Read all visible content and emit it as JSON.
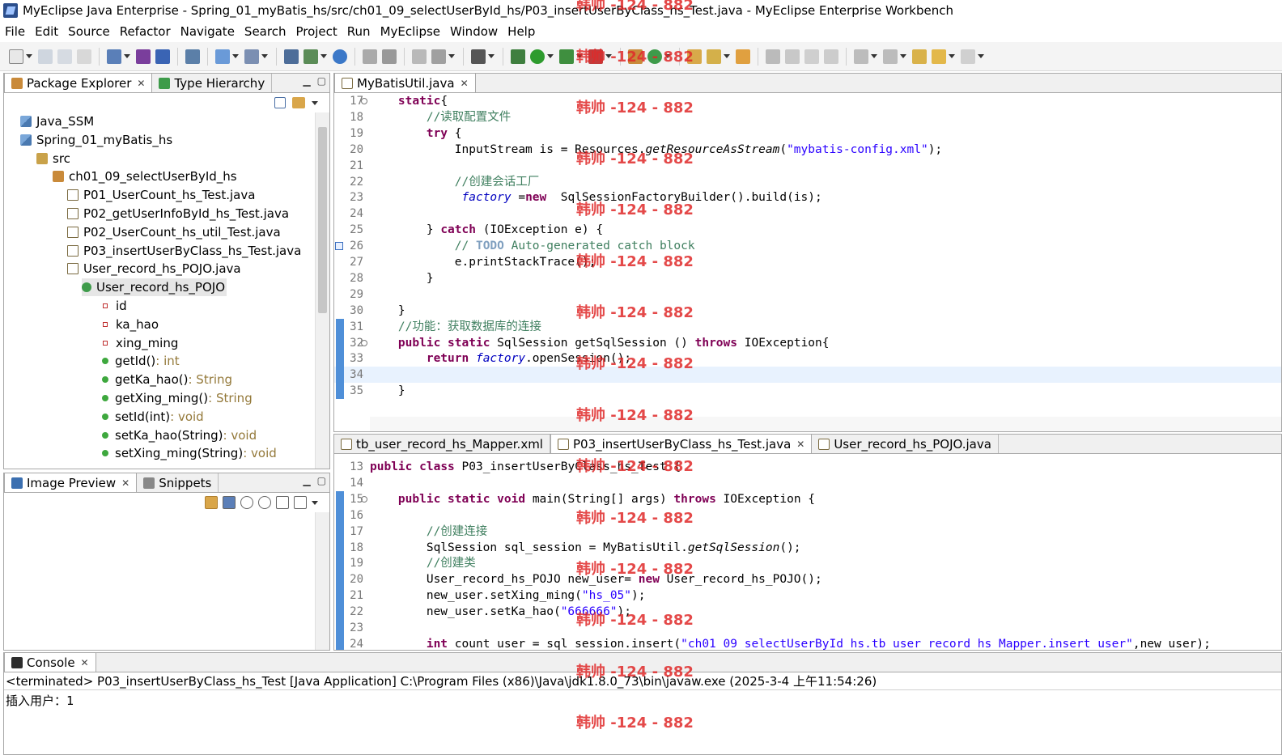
{
  "window": {
    "title": "MyEclipse Java Enterprise - Spring_01_myBatis_hs/src/ch01_09_selectUserById_hs/P03_insertUserByClass_hs_Test.java - MyEclipse Enterprise Workbench"
  },
  "menu": [
    "File",
    "Edit",
    "Source",
    "Refactor",
    "Navigate",
    "Search",
    "Project",
    "Run",
    "MyEclipse",
    "Window",
    "Help"
  ],
  "package_explorer": {
    "tabs": [
      {
        "label": "Package Explorer",
        "icon": "package-explorer-icon",
        "active": true
      },
      {
        "label": "Type Hierarchy",
        "icon": "type-hierarchy-icon",
        "active": false
      }
    ],
    "tree": [
      {
        "depth": 0,
        "icon": "project",
        "label": "Java_SSM"
      },
      {
        "depth": 0,
        "icon": "project",
        "label": "Spring_01_myBatis_hs"
      },
      {
        "depth": 1,
        "icon": "src",
        "label": "src"
      },
      {
        "depth": 2,
        "icon": "package",
        "label": "ch01_09_selectUserById_hs"
      },
      {
        "depth": 3,
        "icon": "java",
        "label": "P01_UserCount_hs_Test.java"
      },
      {
        "depth": 3,
        "icon": "java",
        "label": "P02_getUserInfoById_hs_Test.java"
      },
      {
        "depth": 3,
        "icon": "java",
        "label": "P02_UserCount_hs_util_Test.java"
      },
      {
        "depth": 3,
        "icon": "java",
        "label": "P03_insertUserByClass_hs_Test.java"
      },
      {
        "depth": 3,
        "icon": "java",
        "label": "User_record_hs_POJO.java"
      },
      {
        "depth": 4,
        "icon": "class",
        "label": "User_record_hs_POJO",
        "selected": true
      },
      {
        "depth": 5,
        "icon": "field",
        "label": "id"
      },
      {
        "depth": 5,
        "icon": "field",
        "label": "ka_hao"
      },
      {
        "depth": 5,
        "icon": "field",
        "label": "xing_ming"
      },
      {
        "depth": 5,
        "icon": "method",
        "label": "getId()",
        "type": " : int"
      },
      {
        "depth": 5,
        "icon": "method",
        "label": "getKa_hao()",
        "type": " : String"
      },
      {
        "depth": 5,
        "icon": "method",
        "label": "getXing_ming()",
        "type": " : String"
      },
      {
        "depth": 5,
        "icon": "method",
        "label": "setId(int)",
        "type": " : void"
      },
      {
        "depth": 5,
        "icon": "method",
        "label": "setKa_hao(String)",
        "type": " : void"
      },
      {
        "depth": 5,
        "icon": "method",
        "label": "setXing_ming(String)",
        "type": " : void"
      }
    ]
  },
  "preview": {
    "tabs": [
      {
        "label": "Image Preview",
        "icon": "image-preview-icon",
        "active": true
      },
      {
        "label": "Snippets",
        "icon": "snippets-icon",
        "active": false
      }
    ]
  },
  "editor_top": {
    "tabs": [
      {
        "label": "MyBatisUtil.java",
        "icon": "java-file-icon",
        "active": true
      }
    ],
    "lines": [
      {
        "n": "17",
        "html": "    <span class='kw'>static</span>{",
        "fold": true
      },
      {
        "n": "18",
        "html": "        <span class='cm'>//读取配置文件</span>"
      },
      {
        "n": "19",
        "html": "        <span class='kw'>try</span> {"
      },
      {
        "n": "20",
        "html": "            InputStream is = Resources.<span class='it'>getResourceAsStream</span>(<span class='st'>\"mybatis-config.xml\"</span>);"
      },
      {
        "n": "21",
        "html": ""
      },
      {
        "n": "22",
        "html": "            <span class='cm'>//创建会话工厂</span>"
      },
      {
        "n": "23",
        "html": "             <span class='fd'>factory</span> =<span class='kw'>new</span>  SqlSessionFactoryBuilder().build(is);"
      },
      {
        "n": "24",
        "html": ""
      },
      {
        "n": "25",
        "html": "        } <span class='kw'>catch</span> (IOException e) {"
      },
      {
        "n": "26",
        "html": "            <span class='cm'>// <span class='todo'>TODO</span> Auto-generated catch block</span>",
        "task": true
      },
      {
        "n": "27",
        "html": "            e.printStackTrace();"
      },
      {
        "n": "28",
        "html": "        }"
      },
      {
        "n": "29",
        "html": ""
      },
      {
        "n": "30",
        "html": "    }"
      },
      {
        "n": "31",
        "html": "    <span class='cm'>//功能：获取数据库的连接</span>",
        "changed": true
      },
      {
        "n": "32",
        "html": "    <span class='kw'>public</span> <span class='kw'>static</span> SqlSession getSqlSession () <span class='kw'>throws</span> IOException{",
        "fold": true,
        "changed": true
      },
      {
        "n": "33",
        "html": "        <span class='kw'>return</span> <span class='fd'>factory</span>.openSession();",
        "changed": true
      },
      {
        "n": "34",
        "html": "",
        "current": true,
        "changed": true
      },
      {
        "n": "35",
        "html": "    }",
        "changed": true
      }
    ]
  },
  "editor_bottom": {
    "tabs": [
      {
        "label": "tb_user_record_hs_Mapper.xml",
        "icon": "xml-file-icon",
        "active": false
      },
      {
        "label": "P03_insertUserByClass_hs_Test.java",
        "icon": "java-file-icon",
        "active": true
      },
      {
        "label": "User_record_hs_POJO.java",
        "icon": "java-file-icon",
        "active": false
      }
    ],
    "lines": [
      {
        "n": "13",
        "html": "<span class='kw'>public</span> <span class='kw'>class</span> P03_insertUserByClass_hs_Test {"
      },
      {
        "n": "14",
        "html": ""
      },
      {
        "n": "15",
        "html": "    <span class='kw'>public</span> <span class='kw'>static</span> <span class='kw'>void</span> main(String[] args) <span class='kw'>throws</span> IOException {",
        "fold": true,
        "changed": true
      },
      {
        "n": "16",
        "html": "",
        "changed": true
      },
      {
        "n": "17",
        "html": "        <span class='cm'>//创建连接</span>",
        "changed": true
      },
      {
        "n": "18",
        "html": "        SqlSession sql_session = MyBatisUtil.<span class='it'>getSqlSession</span>();",
        "changed": true
      },
      {
        "n": "19",
        "html": "        <span class='cm'>//创建类</span>",
        "changed": true
      },
      {
        "n": "20",
        "html": "        User_record_hs_POJO new_user= <span class='kw'>new</span> User_record_hs_POJO();",
        "changed": true
      },
      {
        "n": "21",
        "html": "        new_user.setXing_ming(<span class='st'>\"hs_05\"</span>);",
        "changed": true
      },
      {
        "n": "22",
        "html": "        new_user.setKa_hao(<span class='st'>\"666666\"</span>);",
        "changed": true
      },
      {
        "n": "23",
        "html": "",
        "changed": true
      },
      {
        "n": "24",
        "html": "        <span class='kw'>int</span> count_user = sql_session.insert(<span class='st'>\"ch01_09_selectUserById_hs.tb_user_record_hs_Mapper.insert_user\"</span>,new_user);",
        "changed": true
      }
    ]
  },
  "console": {
    "tab": "Console",
    "description": "<terminated> P03_insertUserByClass_hs_Test [Java Application] C:\\Program Files (x86)\\Java\\jdk1.8.0_73\\bin\\javaw.exe (2025-3-4 上午11:54:26)",
    "output": "插入用户：1"
  },
  "watermark": "韩帅 -124 - 882",
  "colors": {
    "keyword": "#7f0055",
    "comment": "#3f7f5f",
    "string": "#2a00ff",
    "field": "#0000c0",
    "watermark": "#e02a2a"
  }
}
